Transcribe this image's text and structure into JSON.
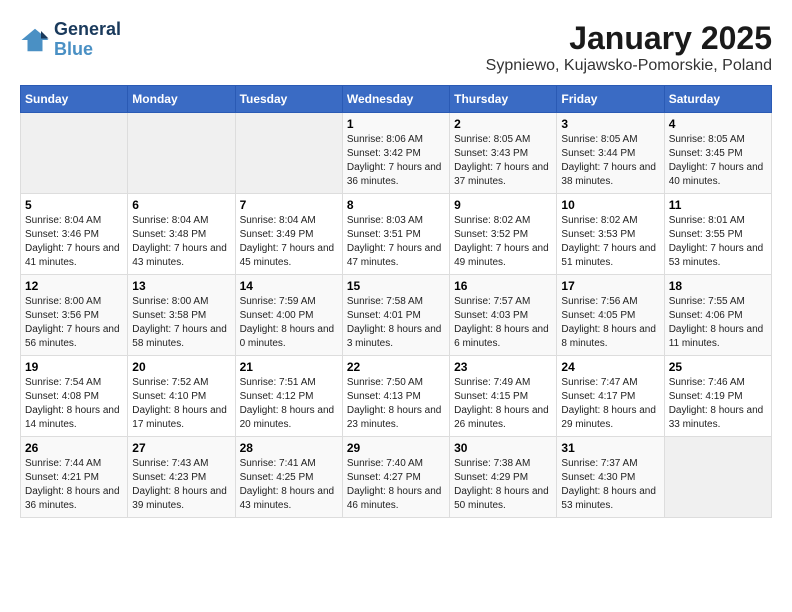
{
  "logo": {
    "line1": "General",
    "line2": "Blue"
  },
  "title": "January 2025",
  "subtitle": "Sypniewo, Kujawsko-Pomorskie, Poland",
  "weekdays": [
    "Sunday",
    "Monday",
    "Tuesday",
    "Wednesday",
    "Thursday",
    "Friday",
    "Saturday"
  ],
  "weeks": [
    [
      {
        "day": "",
        "info": ""
      },
      {
        "day": "",
        "info": ""
      },
      {
        "day": "",
        "info": ""
      },
      {
        "day": "1",
        "info": "Sunrise: 8:06 AM\nSunset: 3:42 PM\nDaylight: 7 hours and 36 minutes."
      },
      {
        "day": "2",
        "info": "Sunrise: 8:05 AM\nSunset: 3:43 PM\nDaylight: 7 hours and 37 minutes."
      },
      {
        "day": "3",
        "info": "Sunrise: 8:05 AM\nSunset: 3:44 PM\nDaylight: 7 hours and 38 minutes."
      },
      {
        "day": "4",
        "info": "Sunrise: 8:05 AM\nSunset: 3:45 PM\nDaylight: 7 hours and 40 minutes."
      }
    ],
    [
      {
        "day": "5",
        "info": "Sunrise: 8:04 AM\nSunset: 3:46 PM\nDaylight: 7 hours and 41 minutes."
      },
      {
        "day": "6",
        "info": "Sunrise: 8:04 AM\nSunset: 3:48 PM\nDaylight: 7 hours and 43 minutes."
      },
      {
        "day": "7",
        "info": "Sunrise: 8:04 AM\nSunset: 3:49 PM\nDaylight: 7 hours and 45 minutes."
      },
      {
        "day": "8",
        "info": "Sunrise: 8:03 AM\nSunset: 3:51 PM\nDaylight: 7 hours and 47 minutes."
      },
      {
        "day": "9",
        "info": "Sunrise: 8:02 AM\nSunset: 3:52 PM\nDaylight: 7 hours and 49 minutes."
      },
      {
        "day": "10",
        "info": "Sunrise: 8:02 AM\nSunset: 3:53 PM\nDaylight: 7 hours and 51 minutes."
      },
      {
        "day": "11",
        "info": "Sunrise: 8:01 AM\nSunset: 3:55 PM\nDaylight: 7 hours and 53 minutes."
      }
    ],
    [
      {
        "day": "12",
        "info": "Sunrise: 8:00 AM\nSunset: 3:56 PM\nDaylight: 7 hours and 56 minutes."
      },
      {
        "day": "13",
        "info": "Sunrise: 8:00 AM\nSunset: 3:58 PM\nDaylight: 7 hours and 58 minutes."
      },
      {
        "day": "14",
        "info": "Sunrise: 7:59 AM\nSunset: 4:00 PM\nDaylight: 8 hours and 0 minutes."
      },
      {
        "day": "15",
        "info": "Sunrise: 7:58 AM\nSunset: 4:01 PM\nDaylight: 8 hours and 3 minutes."
      },
      {
        "day": "16",
        "info": "Sunrise: 7:57 AM\nSunset: 4:03 PM\nDaylight: 8 hours and 6 minutes."
      },
      {
        "day": "17",
        "info": "Sunrise: 7:56 AM\nSunset: 4:05 PM\nDaylight: 8 hours and 8 minutes."
      },
      {
        "day": "18",
        "info": "Sunrise: 7:55 AM\nSunset: 4:06 PM\nDaylight: 8 hours and 11 minutes."
      }
    ],
    [
      {
        "day": "19",
        "info": "Sunrise: 7:54 AM\nSunset: 4:08 PM\nDaylight: 8 hours and 14 minutes."
      },
      {
        "day": "20",
        "info": "Sunrise: 7:52 AM\nSunset: 4:10 PM\nDaylight: 8 hours and 17 minutes."
      },
      {
        "day": "21",
        "info": "Sunrise: 7:51 AM\nSunset: 4:12 PM\nDaylight: 8 hours and 20 minutes."
      },
      {
        "day": "22",
        "info": "Sunrise: 7:50 AM\nSunset: 4:13 PM\nDaylight: 8 hours and 23 minutes."
      },
      {
        "day": "23",
        "info": "Sunrise: 7:49 AM\nSunset: 4:15 PM\nDaylight: 8 hours and 26 minutes."
      },
      {
        "day": "24",
        "info": "Sunrise: 7:47 AM\nSunset: 4:17 PM\nDaylight: 8 hours and 29 minutes."
      },
      {
        "day": "25",
        "info": "Sunrise: 7:46 AM\nSunset: 4:19 PM\nDaylight: 8 hours and 33 minutes."
      }
    ],
    [
      {
        "day": "26",
        "info": "Sunrise: 7:44 AM\nSunset: 4:21 PM\nDaylight: 8 hours and 36 minutes."
      },
      {
        "day": "27",
        "info": "Sunrise: 7:43 AM\nSunset: 4:23 PM\nDaylight: 8 hours and 39 minutes."
      },
      {
        "day": "28",
        "info": "Sunrise: 7:41 AM\nSunset: 4:25 PM\nDaylight: 8 hours and 43 minutes."
      },
      {
        "day": "29",
        "info": "Sunrise: 7:40 AM\nSunset: 4:27 PM\nDaylight: 8 hours and 46 minutes."
      },
      {
        "day": "30",
        "info": "Sunrise: 7:38 AM\nSunset: 4:29 PM\nDaylight: 8 hours and 50 minutes."
      },
      {
        "day": "31",
        "info": "Sunrise: 7:37 AM\nSunset: 4:30 PM\nDaylight: 8 hours and 53 minutes."
      },
      {
        "day": "",
        "info": ""
      }
    ]
  ]
}
